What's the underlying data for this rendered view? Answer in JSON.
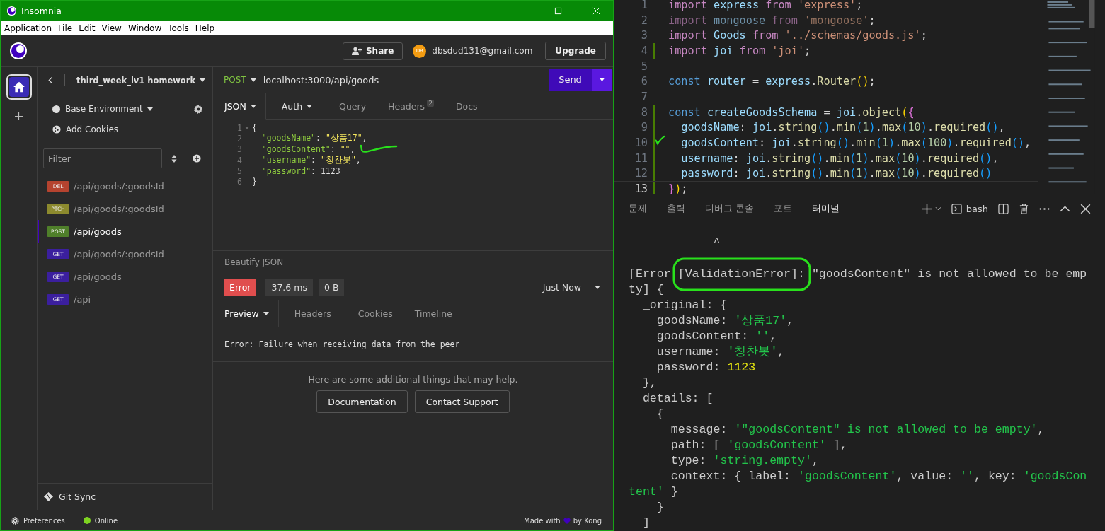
{
  "insomnia": {
    "window": {
      "title": "Insomnia"
    },
    "menu": [
      "Application",
      "File",
      "Edit",
      "View",
      "Window",
      "Tools",
      "Help"
    ],
    "top_bar": {
      "share": "Share",
      "avatar": "DB",
      "email": "dbsdud131@gmail.com",
      "upgrade": "Upgrade"
    },
    "sidebar": {
      "workspace": "third_week_lv1 homework",
      "environment": "Base Environment",
      "cookies": "Add Cookies",
      "filter_placeholder": "Filter",
      "requests": [
        {
          "method": "DEL",
          "path": "/api/goods/:goodsId",
          "color": "#b5432f",
          "selected": false
        },
        {
          "method": "PTCH",
          "path": "/api/goods/:goodsId",
          "color": "#8c8a2e",
          "selected": false
        },
        {
          "method": "POST",
          "path": "/api/goods",
          "color": "#4f7f2a",
          "selected": true
        },
        {
          "method": "GET",
          "path": "/api/goods/:goodsId",
          "color": "#3b1f9e",
          "selected": false
        },
        {
          "method": "GET",
          "path": "/api/goods",
          "color": "#3b1f9e",
          "selected": false
        },
        {
          "method": "GET",
          "path": "/api",
          "color": "#3b1f9e",
          "selected": false
        }
      ],
      "git_sync": "Git Sync"
    },
    "request": {
      "method": "POST",
      "url": "localhost:3000/api/goods",
      "send": "Send",
      "tabs": [
        {
          "label": "JSON",
          "selected": true,
          "dropdown": true
        },
        {
          "label": "Auth",
          "selected": false,
          "dropdown": true
        },
        {
          "label": "Query",
          "selected": false,
          "dropdown": false
        },
        {
          "label": "Headers",
          "selected": false,
          "dropdown": false,
          "badge": "2"
        },
        {
          "label": "Docs",
          "selected": false,
          "dropdown": false
        }
      ],
      "body_lines": [
        {
          "n": "1",
          "fold": true,
          "tokens": [
            {
              "text": "{",
              "kind": "p"
            }
          ]
        },
        {
          "n": "2",
          "fold": false,
          "tokens": [
            {
              "text": "  \"goodsName\"",
              "kind": "k"
            },
            {
              "text": ": ",
              "kind": "p"
            },
            {
              "text": "\"상품17\"",
              "kind": "s"
            },
            {
              "text": ",",
              "kind": "p"
            }
          ]
        },
        {
          "n": "3",
          "fold": false,
          "tokens": [
            {
              "text": "  \"goodsContent\"",
              "kind": "k"
            },
            {
              "text": ": ",
              "kind": "p"
            },
            {
              "text": "\"\"",
              "kind": "s"
            },
            {
              "text": ",",
              "kind": "p"
            }
          ]
        },
        {
          "n": "4",
          "fold": false,
          "tokens": [
            {
              "text": "  \"username\"",
              "kind": "k"
            },
            {
              "text": ": ",
              "kind": "p"
            },
            {
              "text": "\"칭찬봇\"",
              "kind": "s"
            },
            {
              "text": ",",
              "kind": "p"
            }
          ]
        },
        {
          "n": "5",
          "fold": false,
          "tokens": [
            {
              "text": "  \"password\"",
              "kind": "k"
            },
            {
              "text": ": 1123",
              "kind": "p"
            }
          ]
        },
        {
          "n": "6",
          "fold": false,
          "tokens": [
            {
              "text": "}",
              "kind": "p"
            }
          ]
        }
      ],
      "beautify": "Beautify JSON"
    },
    "response": {
      "status": "Error",
      "time": "37.6 ms",
      "size": "0 B",
      "when": "Just Now",
      "tabs": [
        {
          "label": "Preview",
          "selected": true,
          "dropdown": true
        },
        {
          "label": "Headers",
          "selected": false,
          "dropdown": false
        },
        {
          "label": "Cookies",
          "selected": false,
          "dropdown": false
        },
        {
          "label": "Timeline",
          "selected": false,
          "dropdown": false
        }
      ],
      "message": "Error: Failure when receiving data from the peer",
      "help": "Here are some additional things that may help.",
      "buttons": [
        "Documentation",
        "Contact Support"
      ]
    },
    "status_bar": {
      "preferences": "Preferences",
      "online": "Online",
      "made_with": "Made with",
      "by": "by Kong"
    }
  },
  "editor": {
    "lines": [
      {
        "n": "1",
        "modified": false,
        "current": false,
        "tokens": [
          {
            "text": "import ",
            "kind": "kw"
          },
          {
            "text": "express ",
            "kind": "var"
          },
          {
            "text": "from ",
            "kind": "kw"
          },
          {
            "text": "'express'",
            "kind": "str"
          },
          {
            "text": ";",
            "kind": "pl"
          }
        ]
      },
      {
        "n": "2",
        "modified": false,
        "current": false,
        "tokens": [
          {
            "text": "import ",
            "kind": "kwd"
          },
          {
            "text": "mongoose ",
            "kind": "vard"
          },
          {
            "text": "from ",
            "kind": "kwd"
          },
          {
            "text": "'mongoose'",
            "kind": "strd"
          },
          {
            "text": ";",
            "kind": "pl"
          }
        ]
      },
      {
        "n": "3",
        "modified": false,
        "current": false,
        "tokens": [
          {
            "text": "import ",
            "kind": "kw"
          },
          {
            "text": "Goods ",
            "kind": "var"
          },
          {
            "text": "from ",
            "kind": "kw"
          },
          {
            "text": "'../schemas/goods.js'",
            "kind": "str"
          },
          {
            "text": ";",
            "kind": "pl"
          }
        ]
      },
      {
        "n": "4",
        "modified": true,
        "current": false,
        "tokens": [
          {
            "text": "import ",
            "kind": "kw"
          },
          {
            "text": "joi ",
            "kind": "var"
          },
          {
            "text": "from ",
            "kind": "kw"
          },
          {
            "text": "'joi'",
            "kind": "str"
          },
          {
            "text": ";",
            "kind": "pl"
          }
        ]
      },
      {
        "n": "5",
        "modified": false,
        "current": false
      },
      {
        "n": "6",
        "modified": false,
        "current": false,
        "tokens": [
          {
            "text": "const ",
            "kind": "const"
          },
          {
            "text": "router",
            "kind": "var"
          },
          {
            "text": " = ",
            "kind": "pl"
          },
          {
            "text": "express",
            "kind": "var"
          },
          {
            "text": ".",
            "kind": "pl"
          },
          {
            "text": "Router",
            "kind": "fn"
          },
          {
            "text": "()",
            "kind": "b1"
          },
          {
            "text": ";",
            "kind": "pl"
          }
        ]
      },
      {
        "n": "7",
        "modified": false,
        "current": false
      },
      {
        "n": "8",
        "modified": true,
        "current": false,
        "tokens": [
          {
            "text": "const ",
            "kind": "const"
          },
          {
            "text": "createGoodsSchema",
            "kind": "var"
          },
          {
            "text": " = ",
            "kind": "pl"
          },
          {
            "text": "joi",
            "kind": "var"
          },
          {
            "text": ".",
            "kind": "pl"
          },
          {
            "text": "object",
            "kind": "fn"
          },
          {
            "text": "(",
            "kind": "b1"
          },
          {
            "text": "{",
            "kind": "b2"
          }
        ]
      },
      {
        "n": "9",
        "modified": true,
        "current": false,
        "tokens": [
          {
            "text": "  goodsName",
            "kind": "var"
          },
          {
            "text": ": ",
            "kind": "pl"
          },
          {
            "text": "joi",
            "kind": "var"
          },
          {
            "text": ".",
            "kind": "pl"
          },
          {
            "text": "string",
            "kind": "fn"
          },
          {
            "text": "()",
            "kind": "b3"
          },
          {
            "text": ".",
            "kind": "pl"
          },
          {
            "text": "min",
            "kind": "fn"
          },
          {
            "text": "(",
            "kind": "b3"
          },
          {
            "text": "1",
            "kind": "num"
          },
          {
            "text": ")",
            "kind": "b3"
          },
          {
            "text": ".",
            "kind": "pl"
          },
          {
            "text": "max",
            "kind": "fn"
          },
          {
            "text": "(",
            "kind": "b3"
          },
          {
            "text": "10",
            "kind": "num"
          },
          {
            "text": ")",
            "kind": "b3"
          },
          {
            "text": ".",
            "kind": "pl"
          },
          {
            "text": "required",
            "kind": "fn"
          },
          {
            "text": "()",
            "kind": "b3"
          },
          {
            "text": ",",
            "kind": "pl"
          }
        ]
      },
      {
        "n": "10",
        "modified": true,
        "current": false,
        "tokens": [
          {
            "text": "  goodsContent",
            "kind": "var"
          },
          {
            "text": ": ",
            "kind": "pl"
          },
          {
            "text": "joi",
            "kind": "var"
          },
          {
            "text": ".",
            "kind": "pl"
          },
          {
            "text": "string",
            "kind": "fn"
          },
          {
            "text": "()",
            "kind": "b3"
          },
          {
            "text": ".",
            "kind": "pl"
          },
          {
            "text": "min",
            "kind": "fn"
          },
          {
            "text": "(",
            "kind": "b3"
          },
          {
            "text": "1",
            "kind": "num"
          },
          {
            "text": ")",
            "kind": "b3"
          },
          {
            "text": ".",
            "kind": "pl"
          },
          {
            "text": "max",
            "kind": "fn"
          },
          {
            "text": "(",
            "kind": "b3"
          },
          {
            "text": "100",
            "kind": "num"
          },
          {
            "text": ")",
            "kind": "b3"
          },
          {
            "text": ".",
            "kind": "pl"
          },
          {
            "text": "required",
            "kind": "fn"
          },
          {
            "text": "()",
            "kind": "b3"
          },
          {
            "text": ",",
            "kind": "pl"
          }
        ]
      },
      {
        "n": "11",
        "modified": true,
        "current": false,
        "tokens": [
          {
            "text": "  username",
            "kind": "var"
          },
          {
            "text": ": ",
            "kind": "pl"
          },
          {
            "text": "joi",
            "kind": "var"
          },
          {
            "text": ".",
            "kind": "pl"
          },
          {
            "text": "string",
            "kind": "fn"
          },
          {
            "text": "()",
            "kind": "b3"
          },
          {
            "text": ".",
            "kind": "pl"
          },
          {
            "text": "min",
            "kind": "fn"
          },
          {
            "text": "(",
            "kind": "b3"
          },
          {
            "text": "1",
            "kind": "num"
          },
          {
            "text": ")",
            "kind": "b3"
          },
          {
            "text": ".",
            "kind": "pl"
          },
          {
            "text": "max",
            "kind": "fn"
          },
          {
            "text": "(",
            "kind": "b3"
          },
          {
            "text": "10",
            "kind": "num"
          },
          {
            "text": ")",
            "kind": "b3"
          },
          {
            "text": ".",
            "kind": "pl"
          },
          {
            "text": "required",
            "kind": "fn"
          },
          {
            "text": "()",
            "kind": "b3"
          },
          {
            "text": ",",
            "kind": "pl"
          }
        ]
      },
      {
        "n": "12",
        "modified": true,
        "current": false,
        "tokens": [
          {
            "text": "  password",
            "kind": "var"
          },
          {
            "text": ": ",
            "kind": "pl"
          },
          {
            "text": "joi",
            "kind": "var"
          },
          {
            "text": ".",
            "kind": "pl"
          },
          {
            "text": "string",
            "kind": "fn"
          },
          {
            "text": "()",
            "kind": "b3"
          },
          {
            "text": ".",
            "kind": "pl"
          },
          {
            "text": "min",
            "kind": "fn"
          },
          {
            "text": "(",
            "kind": "b3"
          },
          {
            "text": "1",
            "kind": "num"
          },
          {
            "text": ")",
            "kind": "b3"
          },
          {
            "text": ".",
            "kind": "pl"
          },
          {
            "text": "max",
            "kind": "fn"
          },
          {
            "text": "(",
            "kind": "b3"
          },
          {
            "text": "10",
            "kind": "num"
          },
          {
            "text": ")",
            "kind": "b3"
          },
          {
            "text": ".",
            "kind": "pl"
          },
          {
            "text": "required",
            "kind": "fn"
          },
          {
            "text": "()",
            "kind": "b3"
          }
        ]
      },
      {
        "n": "13",
        "modified": true,
        "current": true,
        "tokens": [
          {
            "text": "}",
            "kind": "b2"
          },
          {
            "text": ")",
            "kind": "b1"
          },
          {
            "text": ";",
            "kind": "pl"
          }
        ]
      }
    ],
    "panel_tabs": [
      {
        "label": "문제",
        "selected": false
      },
      {
        "label": "출력",
        "selected": false
      },
      {
        "label": "디버그 콘솔",
        "selected": false
      },
      {
        "label": "포트",
        "selected": false
      },
      {
        "label": "터미널",
        "selected": true
      }
    ],
    "shell": "bash",
    "caret_line": "            ^",
    "terminal": [
      [
        {
          "text": "[Error [ValidationError]: \"goodsContent\" is not allowed to be emp",
          "kind": "pl"
        }
      ],
      [
        {
          "text": "ty] {",
          "kind": "pl"
        }
      ],
      [
        {
          "text": "  _original: {",
          "kind": "pl"
        }
      ],
      [
        {
          "text": "    goodsName: ",
          "kind": "pl"
        },
        {
          "text": "'상품17'",
          "kind": "str"
        },
        {
          "text": ",",
          "kind": "pl"
        }
      ],
      [
        {
          "text": "    goodsContent: ",
          "kind": "pl"
        },
        {
          "text": "''",
          "kind": "str"
        },
        {
          "text": ",",
          "kind": "pl"
        }
      ],
      [
        {
          "text": "    username: ",
          "kind": "pl"
        },
        {
          "text": "'칭찬봇'",
          "kind": "str"
        },
        {
          "text": ",",
          "kind": "pl"
        }
      ],
      [
        {
          "text": "    password: ",
          "kind": "pl"
        },
        {
          "text": "1123",
          "kind": "num"
        }
      ],
      [
        {
          "text": "  },",
          "kind": "pl"
        }
      ],
      [
        {
          "text": "  details: [",
          "kind": "pl"
        }
      ],
      [
        {
          "text": "    {",
          "kind": "pl"
        }
      ],
      [
        {
          "text": "      message: ",
          "kind": "pl"
        },
        {
          "text": "'\"goodsContent\" is not allowed to be empty'",
          "kind": "str"
        },
        {
          "text": ",",
          "kind": "pl"
        }
      ],
      [
        {
          "text": "      path: [ ",
          "kind": "pl"
        },
        {
          "text": "'goodsContent'",
          "kind": "str"
        },
        {
          "text": " ],",
          "kind": "pl"
        }
      ],
      [
        {
          "text": "      type: ",
          "kind": "pl"
        },
        {
          "text": "'string.empty'",
          "kind": "str"
        },
        {
          "text": ",",
          "kind": "pl"
        }
      ],
      [
        {
          "text": "      context: { label: ",
          "kind": "pl"
        },
        {
          "text": "'goodsContent'",
          "kind": "str"
        },
        {
          "text": ", value: ",
          "kind": "pl"
        },
        {
          "text": "''",
          "kind": "str"
        },
        {
          "text": ", key: ",
          "kind": "pl"
        },
        {
          "text": "'goodsCon",
          "kind": "str"
        }
      ],
      [
        {
          "text": "tent'",
          "kind": "str"
        },
        {
          "text": " }",
          "kind": "pl"
        }
      ],
      [
        {
          "text": "    }",
          "kind": "pl"
        }
      ],
      [
        {
          "text": "  ]",
          "kind": "pl"
        }
      ]
    ]
  }
}
